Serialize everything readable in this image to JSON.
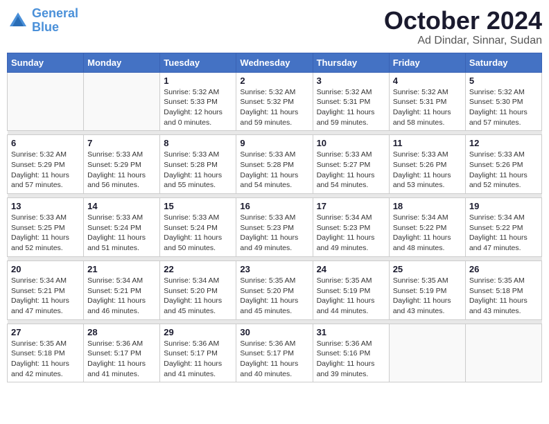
{
  "header": {
    "logo_line1": "General",
    "logo_line2": "Blue",
    "month": "October 2024",
    "location": "Ad Dindar, Sinnar, Sudan"
  },
  "weekdays": [
    "Sunday",
    "Monday",
    "Tuesday",
    "Wednesday",
    "Thursday",
    "Friday",
    "Saturday"
  ],
  "weeks": [
    [
      {
        "day": "",
        "info": ""
      },
      {
        "day": "",
        "info": ""
      },
      {
        "day": "1",
        "info": "Sunrise: 5:32 AM\nSunset: 5:33 PM\nDaylight: 12 hours\nand 0 minutes."
      },
      {
        "day": "2",
        "info": "Sunrise: 5:32 AM\nSunset: 5:32 PM\nDaylight: 11 hours\nand 59 minutes."
      },
      {
        "day": "3",
        "info": "Sunrise: 5:32 AM\nSunset: 5:31 PM\nDaylight: 11 hours\nand 59 minutes."
      },
      {
        "day": "4",
        "info": "Sunrise: 5:32 AM\nSunset: 5:31 PM\nDaylight: 11 hours\nand 58 minutes."
      },
      {
        "day": "5",
        "info": "Sunrise: 5:32 AM\nSunset: 5:30 PM\nDaylight: 11 hours\nand 57 minutes."
      }
    ],
    [
      {
        "day": "6",
        "info": "Sunrise: 5:32 AM\nSunset: 5:29 PM\nDaylight: 11 hours\nand 57 minutes."
      },
      {
        "day": "7",
        "info": "Sunrise: 5:33 AM\nSunset: 5:29 PM\nDaylight: 11 hours\nand 56 minutes."
      },
      {
        "day": "8",
        "info": "Sunrise: 5:33 AM\nSunset: 5:28 PM\nDaylight: 11 hours\nand 55 minutes."
      },
      {
        "day": "9",
        "info": "Sunrise: 5:33 AM\nSunset: 5:28 PM\nDaylight: 11 hours\nand 54 minutes."
      },
      {
        "day": "10",
        "info": "Sunrise: 5:33 AM\nSunset: 5:27 PM\nDaylight: 11 hours\nand 54 minutes."
      },
      {
        "day": "11",
        "info": "Sunrise: 5:33 AM\nSunset: 5:26 PM\nDaylight: 11 hours\nand 53 minutes."
      },
      {
        "day": "12",
        "info": "Sunrise: 5:33 AM\nSunset: 5:26 PM\nDaylight: 11 hours\nand 52 minutes."
      }
    ],
    [
      {
        "day": "13",
        "info": "Sunrise: 5:33 AM\nSunset: 5:25 PM\nDaylight: 11 hours\nand 52 minutes."
      },
      {
        "day": "14",
        "info": "Sunrise: 5:33 AM\nSunset: 5:24 PM\nDaylight: 11 hours\nand 51 minutes."
      },
      {
        "day": "15",
        "info": "Sunrise: 5:33 AM\nSunset: 5:24 PM\nDaylight: 11 hours\nand 50 minutes."
      },
      {
        "day": "16",
        "info": "Sunrise: 5:33 AM\nSunset: 5:23 PM\nDaylight: 11 hours\nand 49 minutes."
      },
      {
        "day": "17",
        "info": "Sunrise: 5:34 AM\nSunset: 5:23 PM\nDaylight: 11 hours\nand 49 minutes."
      },
      {
        "day": "18",
        "info": "Sunrise: 5:34 AM\nSunset: 5:22 PM\nDaylight: 11 hours\nand 48 minutes."
      },
      {
        "day": "19",
        "info": "Sunrise: 5:34 AM\nSunset: 5:22 PM\nDaylight: 11 hours\nand 47 minutes."
      }
    ],
    [
      {
        "day": "20",
        "info": "Sunrise: 5:34 AM\nSunset: 5:21 PM\nDaylight: 11 hours\nand 47 minutes."
      },
      {
        "day": "21",
        "info": "Sunrise: 5:34 AM\nSunset: 5:21 PM\nDaylight: 11 hours\nand 46 minutes."
      },
      {
        "day": "22",
        "info": "Sunrise: 5:34 AM\nSunset: 5:20 PM\nDaylight: 11 hours\nand 45 minutes."
      },
      {
        "day": "23",
        "info": "Sunrise: 5:35 AM\nSunset: 5:20 PM\nDaylight: 11 hours\nand 45 minutes."
      },
      {
        "day": "24",
        "info": "Sunrise: 5:35 AM\nSunset: 5:19 PM\nDaylight: 11 hours\nand 44 minutes."
      },
      {
        "day": "25",
        "info": "Sunrise: 5:35 AM\nSunset: 5:19 PM\nDaylight: 11 hours\nand 43 minutes."
      },
      {
        "day": "26",
        "info": "Sunrise: 5:35 AM\nSunset: 5:18 PM\nDaylight: 11 hours\nand 43 minutes."
      }
    ],
    [
      {
        "day": "27",
        "info": "Sunrise: 5:35 AM\nSunset: 5:18 PM\nDaylight: 11 hours\nand 42 minutes."
      },
      {
        "day": "28",
        "info": "Sunrise: 5:36 AM\nSunset: 5:17 PM\nDaylight: 11 hours\nand 41 minutes."
      },
      {
        "day": "29",
        "info": "Sunrise: 5:36 AM\nSunset: 5:17 PM\nDaylight: 11 hours\nand 41 minutes."
      },
      {
        "day": "30",
        "info": "Sunrise: 5:36 AM\nSunset: 5:17 PM\nDaylight: 11 hours\nand 40 minutes."
      },
      {
        "day": "31",
        "info": "Sunrise: 5:36 AM\nSunset: 5:16 PM\nDaylight: 11 hours\nand 39 minutes."
      },
      {
        "day": "",
        "info": ""
      },
      {
        "day": "",
        "info": ""
      }
    ]
  ]
}
